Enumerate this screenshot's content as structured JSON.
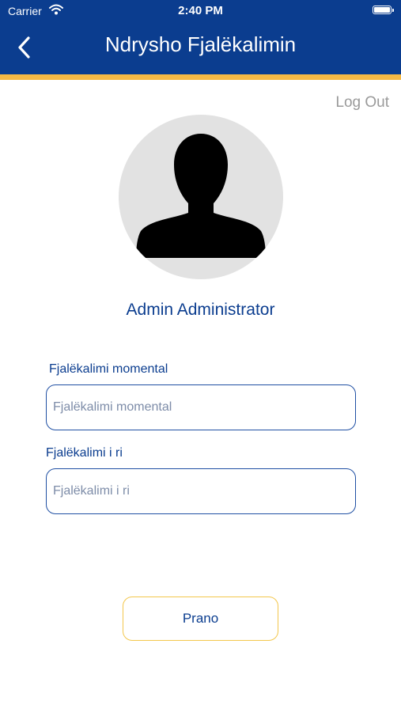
{
  "status_bar": {
    "carrier": "Carrier",
    "time": "2:40 PM",
    "icons": [
      "wifi-icon",
      "battery-icon"
    ]
  },
  "nav": {
    "title": "Ndrysho Fjalëkalimin",
    "back_icon": "chevron-left-icon"
  },
  "header": {
    "logout_label": "Log Out"
  },
  "profile": {
    "avatar_icon": "person-silhouette-icon",
    "name": "Admin Administrator"
  },
  "form": {
    "current_password": {
      "label": "Fjalëkalimi momental",
      "placeholder": "Fjalëkalimi momental",
      "value": ""
    },
    "new_password": {
      "label": "Fjalëkalimi i ri",
      "placeholder": "Fjalëkalimi i ri",
      "value": ""
    },
    "submit_label": "Prano"
  },
  "colors": {
    "primary": "#0b3d8f",
    "accent": "#f5b945",
    "button_border": "#f3c74c",
    "muted_text": "#9a9a9a",
    "avatar_bg": "#e2e2e2"
  }
}
